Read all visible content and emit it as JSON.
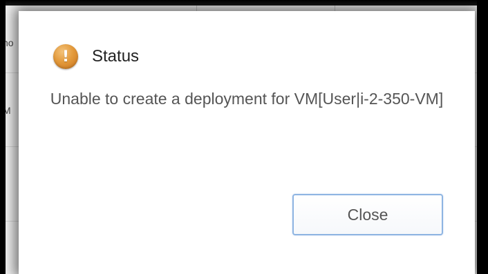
{
  "background": {
    "visible_fragments": [
      "no",
      "M"
    ]
  },
  "dialog": {
    "title": "Status",
    "icon": "alert-exclamation-icon",
    "icon_glyph": "!",
    "icon_color": "#e39a3c",
    "message": "Unable to create a deployment for VM[User|i-2-350-VM]",
    "close_label": "Close",
    "button_border_color": "#8eb4e2"
  }
}
